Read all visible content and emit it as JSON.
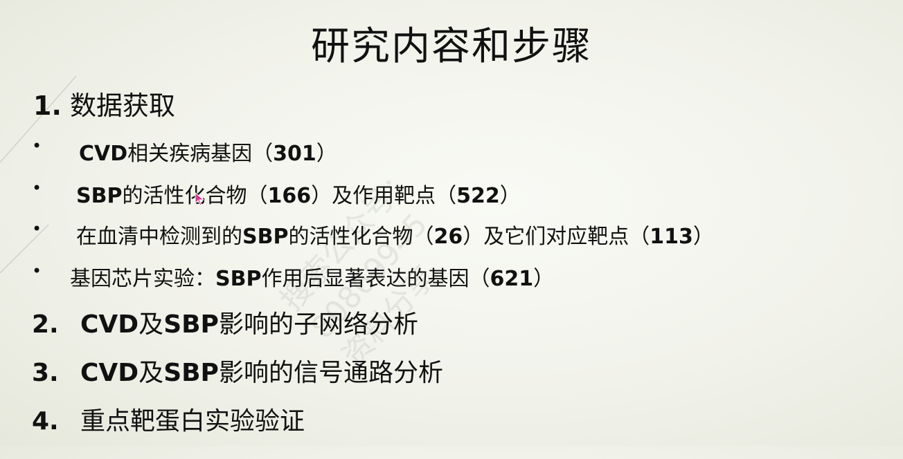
{
  "title": "研究内容和步骤",
  "sections": [
    {
      "num": "1.",
      "label": "数据获取"
    }
  ],
  "bullets": [
    {
      "dot": "•",
      "plain1": "",
      "bold1": "CVD",
      "plain2": "相关疾病基因（",
      "bold2": "301",
      "plain3": "）"
    },
    {
      "dot": "•",
      "bold1": "SBP",
      "plain1": "的活性化合物（",
      "bold2": "166",
      "plain2": "）及作用靶点（",
      "bold3": "522",
      "plain3": "）"
    },
    {
      "dot": "•",
      "plain1": "在血清中检测到的",
      "bold1": "SBP",
      "plain2": "的活性化合物（",
      "bold2": "26",
      "plain3": "）及它们对应靶点（",
      "bold3": "113",
      "plain4": "）"
    },
    {
      "dot": "•",
      "plain1": "基因芯片实验：",
      "bold1": "SBP",
      "plain2": "作用后显著表达的基因（",
      "bold2": "621",
      "plain3": "）"
    }
  ],
  "steps": [
    {
      "num": "2.",
      "bold1": "CVD",
      "plain1": "及",
      "bold2": "SBP",
      "plain2": "影响的子网络分析"
    },
    {
      "num": "3.",
      "bold1": "CVD",
      "plain1": "及",
      "bold2": "SBP",
      "plain2": "影响的信号通路分析"
    },
    {
      "num": "4.",
      "plain1": "重点靶蛋白实验验证"
    }
  ],
  "watermark": {
    "line1": "搜索公众号：",
    "line2": "80869945",
    "line3": "资料分享"
  },
  "colors": {
    "text": "#111111",
    "background": "#f1f2ea"
  }
}
